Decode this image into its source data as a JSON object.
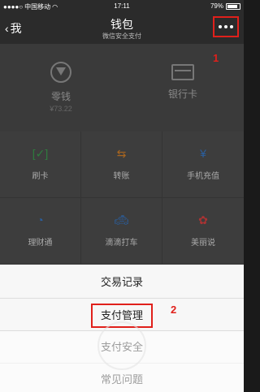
{
  "status_bar": {
    "carrier": "中国移动",
    "time": "17:11",
    "battery": "79%"
  },
  "nav": {
    "back_label": "我",
    "title": "钱包",
    "subtitle": "微信安全支付"
  },
  "annotations": {
    "one": "1",
    "two": "2"
  },
  "header": {
    "change_label": "零钱",
    "change_amount": "¥73.22",
    "bank_card_label": "银行卡"
  },
  "grid": {
    "items": [
      {
        "label": "刷卡",
        "icon": "scan-card-icon"
      },
      {
        "label": "转账",
        "icon": "transfer-icon"
      },
      {
        "label": "手机充值",
        "icon": "mobile-topup-icon"
      },
      {
        "label": "理财通",
        "icon": "wealth-icon"
      },
      {
        "label": "滴滴打车",
        "icon": "taxi-icon"
      },
      {
        "label": "美丽说",
        "icon": "meilishuo-icon"
      }
    ]
  },
  "sheet": {
    "items": [
      {
        "label": "交易记录"
      },
      {
        "label": "支付管理"
      },
      {
        "label": "支付安全"
      },
      {
        "label": "常见问题"
      }
    ]
  },
  "colors": {
    "annotation_red": "#e0201b",
    "navbar_bg": "#2b2b2b",
    "sheet_bg": "#f7f7f7"
  }
}
